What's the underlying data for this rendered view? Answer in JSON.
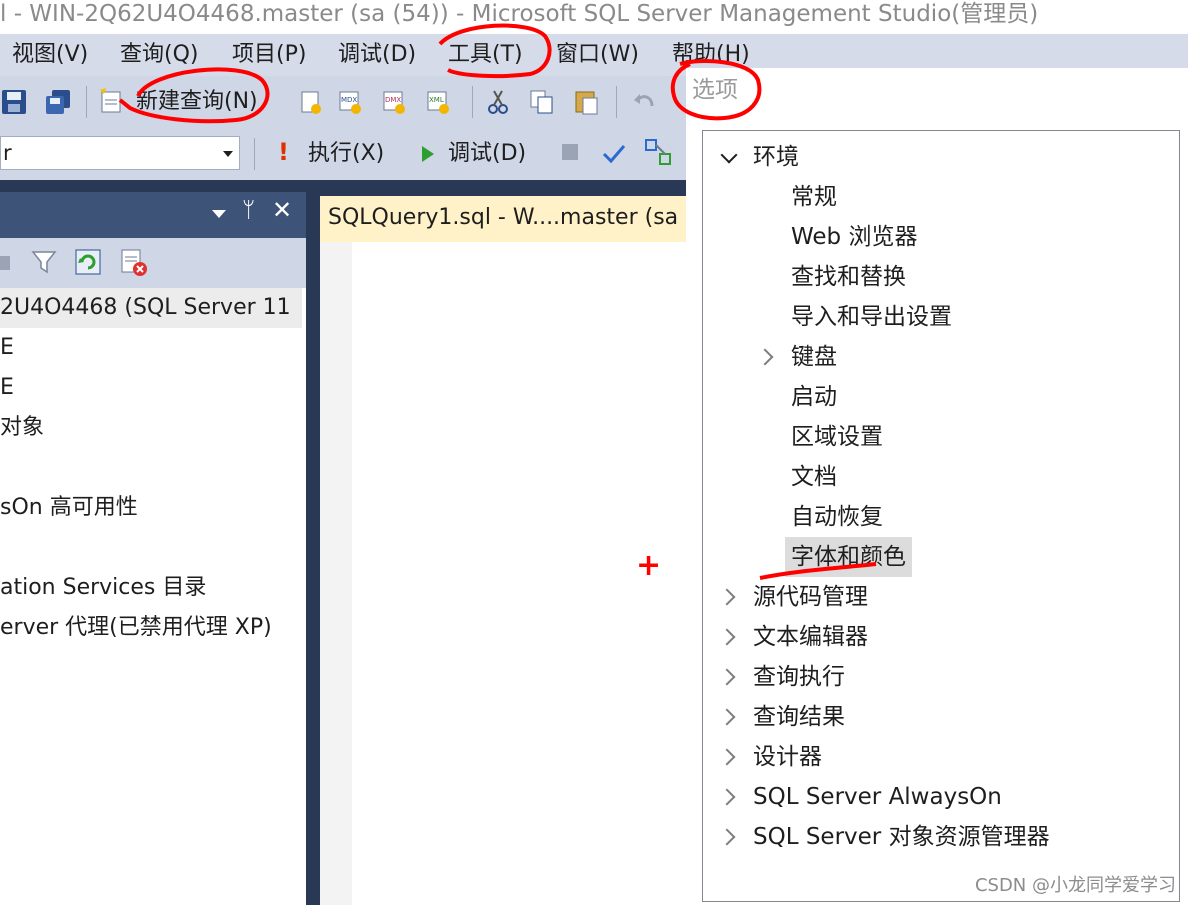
{
  "window": {
    "title": "l - WIN-2Q62U4O4468.master (sa (54)) - Microsoft SQL Server Management Studio(管理员)"
  },
  "menu": {
    "items": [
      {
        "label": "视图(V)"
      },
      {
        "label": "查询(Q)"
      },
      {
        "label": "项目(P)"
      },
      {
        "label": "调试(D)"
      },
      {
        "label": "工具(T)"
      },
      {
        "label": "窗口(W)"
      },
      {
        "label": "帮助(H)"
      }
    ]
  },
  "toolbar1": {
    "new_query_label": "新建查询(N)"
  },
  "toolbar2": {
    "database_value": "r",
    "execute_label": "执行(X)",
    "debug_label": "调试(D)"
  },
  "object_explorer": {
    "rows": [
      {
        "label": "2U4O4468 (SQL Server 11"
      },
      {
        "label": "E"
      },
      {
        "label": "E"
      },
      {
        "label": "对象"
      },
      {
        "label": ""
      },
      {
        "label": "sOn 高可用性"
      },
      {
        "label": ""
      },
      {
        "label": "ation Services 目录"
      },
      {
        "label": "erver 代理(已禁用代理 XP)"
      }
    ]
  },
  "editor": {
    "tab_label": "SQLQuery1.sql - W....master (sa"
  },
  "options": {
    "title": "选项",
    "environment_label": "环境",
    "environment_children": [
      {
        "label": "常规",
        "expandable": false
      },
      {
        "label": "Web 浏览器",
        "expandable": false
      },
      {
        "label": "查找和替换",
        "expandable": false
      },
      {
        "label": "导入和导出设置",
        "expandable": false
      },
      {
        "label": "键盘",
        "expandable": true
      },
      {
        "label": "启动",
        "expandable": false
      },
      {
        "label": "区域设置",
        "expandable": false
      },
      {
        "label": "文档",
        "expandable": false
      },
      {
        "label": "自动恢复",
        "expandable": false
      },
      {
        "label": "字体和颜色",
        "expandable": false,
        "selected": true
      }
    ],
    "top_level": [
      {
        "label": "源代码管理"
      },
      {
        "label": "文本编辑器"
      },
      {
        "label": "查询执行"
      },
      {
        "label": "查询结果"
      },
      {
        "label": "设计器"
      },
      {
        "label": "SQL Server AlwaysOn"
      },
      {
        "label": "SQL Server 对象资源管理器"
      }
    ]
  },
  "watermark": "CSDN @小龙同学爱学习",
  "colors": {
    "menu_bg": "#d6dbe9",
    "toolbar_bg": "#cfd6e5",
    "dark_bg": "#293955",
    "panel_header": "#3e5378",
    "tab_active": "#fff2c8",
    "annotation_red": "#ff0000"
  }
}
